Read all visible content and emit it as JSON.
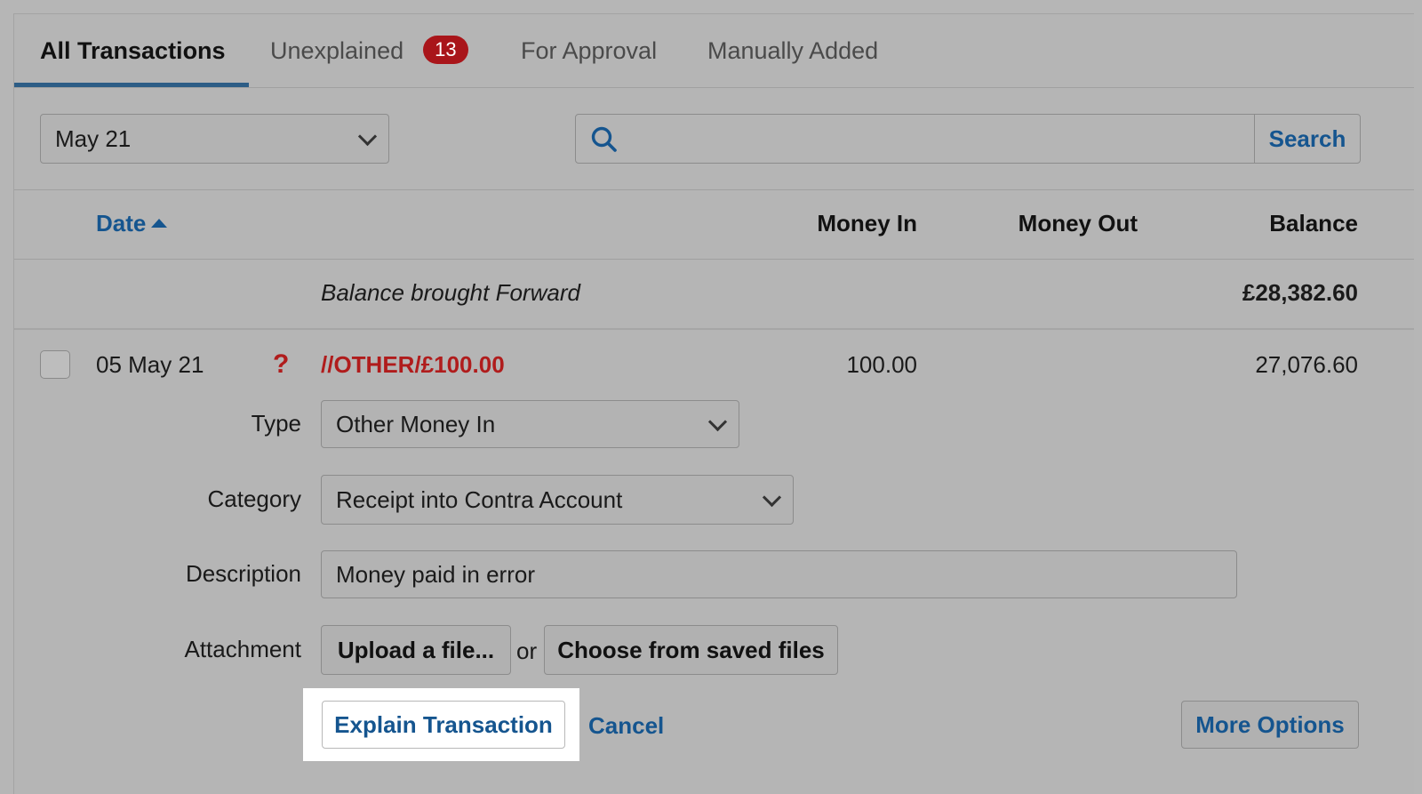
{
  "tabs": [
    {
      "label": "All Transactions"
    },
    {
      "label": "Unexplained",
      "badge": "13"
    },
    {
      "label": "For Approval"
    },
    {
      "label": "Manually Added"
    }
  ],
  "filter": {
    "period_value": "May 21",
    "search_button": "Search"
  },
  "columns": {
    "date": "Date",
    "money_in": "Money In",
    "money_out": "Money Out",
    "balance": "Balance"
  },
  "balance_forward": {
    "label": "Balance brought Forward",
    "amount": "£28,382.60"
  },
  "transaction": {
    "date": "05 May 21",
    "status_glyph": "?",
    "description": "//OTHER/£100.00",
    "money_in": "100.00",
    "balance": "27,076.60"
  },
  "form": {
    "type_label": "Type",
    "type_value": "Other Money In",
    "category_label": "Category",
    "category_value": "Receipt into Contra Account",
    "description_label": "Description",
    "description_value": "Money paid in error",
    "attachment_label": "Attachment",
    "upload_button": "Upload a file...",
    "or_text": "or",
    "saved_files_button": "Choose from saved files"
  },
  "actions": {
    "explain": "Explain Transaction",
    "cancel": "Cancel",
    "more_options": "More Options"
  },
  "colors": {
    "accent_blue": "#15558f",
    "badge_red": "#a9151a",
    "unexplained_red": "#b01c1c"
  }
}
